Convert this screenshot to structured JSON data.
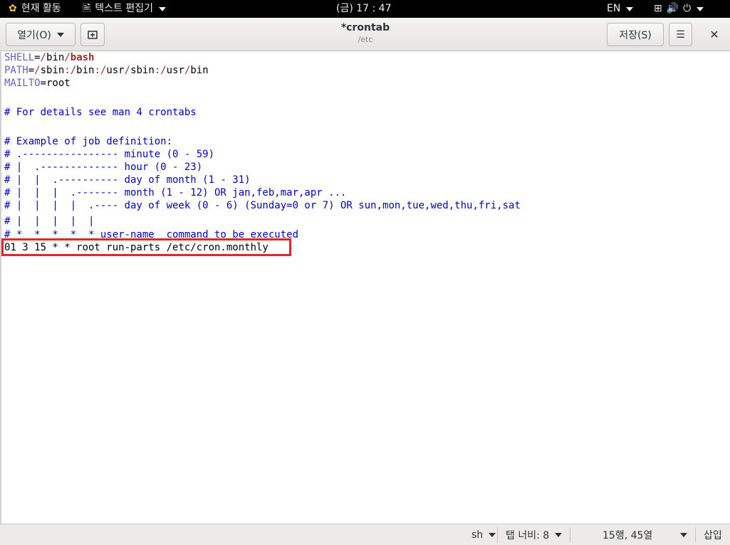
{
  "topbar": {
    "activities": "현재 활동",
    "app_menu": "텍스트 편집기",
    "clock": "(금) 17 : 47",
    "lang": "EN"
  },
  "header": {
    "open_label": "열기(O)",
    "title": "*crontab",
    "subtitle": "/etc",
    "save_label": "저장(S)"
  },
  "editor": {
    "lines": [
      {
        "var": "SHELL",
        "rest": "=/bin/bash"
      },
      {
        "var": "PATH",
        "rest": "=/sbin:/bin:/usr/sbin:/usr/bin"
      },
      {
        "var": "MAILTO",
        "rest": "=root"
      },
      {
        "comment": "# For details see man 4 crontabs"
      },
      {
        "comment": "# Example of job definition:"
      },
      {
        "comment": "# .---------------- minute (0 - 59)"
      },
      {
        "comment": "# |  .------------- hour (0 - 23)"
      },
      {
        "comment": "# |  |  .---------- day of month (1 - 31)"
      },
      {
        "comment": "# |  |  |  .------- month (1 - 12) OR jan,feb,mar,apr ..."
      },
      {
        "comment": "# |  |  |  |  .---- day of week (0 - 6) (Sunday=0 or 7) OR sun,mon,tue,wed,thu,fri,sat"
      },
      {
        "comment": "# |  |  |  |  |"
      },
      {
        "comment": "# *  *  *  *  * user-name  command to be executed"
      },
      {
        "text": "01 3 15 * * root run-parts /etc/cron.monthly"
      }
    ]
  },
  "statusbar": {
    "language": "sh",
    "tab_width": "탭 너비: 8",
    "position": "15행, 45열",
    "mode": "삽입"
  },
  "colors": {
    "highlight_box": "#e3262b",
    "comment": "#0000cd",
    "variable": "#6a5acd"
  }
}
